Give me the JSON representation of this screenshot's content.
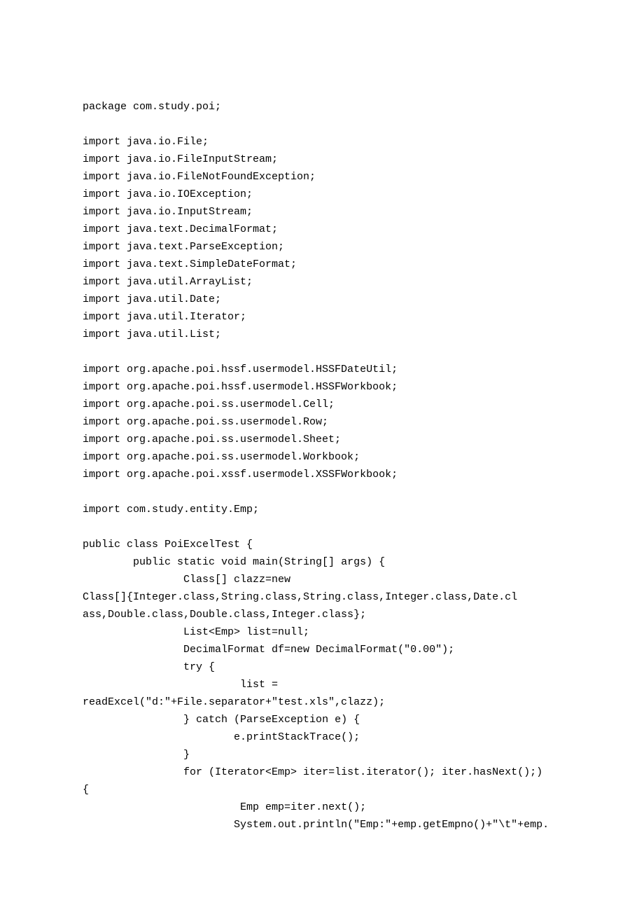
{
  "code_lines": [
    "package com.study.poi;",
    "",
    "import java.io.File;",
    "import java.io.FileInputStream;",
    "import java.io.FileNotFoundException;",
    "import java.io.IOException;",
    "import java.io.InputStream;",
    "import java.text.DecimalFormat;",
    "import java.text.ParseException;",
    "import java.text.SimpleDateFormat;",
    "import java.util.ArrayList;",
    "import java.util.Date;",
    "import java.util.Iterator;",
    "import java.util.List;",
    "",
    "import org.apache.poi.hssf.usermodel.HSSFDateUtil;",
    "import org.apache.poi.hssf.usermodel.HSSFWorkbook;",
    "import org.apache.poi.ss.usermodel.Cell;",
    "import org.apache.poi.ss.usermodel.Row;",
    "import org.apache.poi.ss.usermodel.Sheet;",
    "import org.apache.poi.ss.usermodel.Workbook;",
    "import org.apache.poi.xssf.usermodel.XSSFWorkbook;",
    "",
    "import com.study.entity.Emp;",
    "",
    "public class PoiExcelTest {",
    "        public static void main(String[] args) {",
    "                Class[] clazz=new",
    "Class[]{Integer.class,String.class,String.class,Integer.class,Date.cl",
    "ass,Double.class,Double.class,Integer.class};",
    "                List<Emp> list=null;",
    "                DecimalFormat df=new DecimalFormat(\"0.00\");",
    "                try {",
    "                         list =",
    "readExcel(\"d:\"+File.separator+\"test.xls\",clazz);",
    "                } catch (ParseException e) {",
    "                        e.printStackTrace();",
    "                }",
    "                for (Iterator<Emp> iter=list.iterator(); iter.hasNext();)",
    "{",
    "                         Emp emp=iter.next();",
    "                        System.out.println(\"Emp:\"+emp.getEmpno()+\"\\t\"+emp."
  ]
}
